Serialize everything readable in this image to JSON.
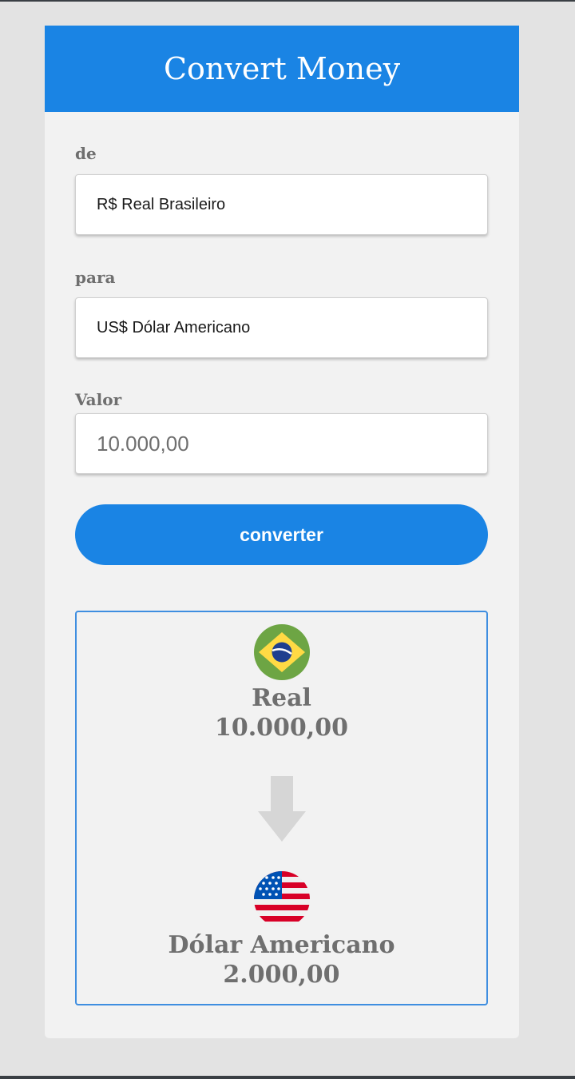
{
  "app": {
    "title": "Convert Money"
  },
  "form": {
    "from_label": "de",
    "from_value": "R$ Real Brasileiro",
    "to_label": "para",
    "to_value": "US$ Dólar Americano",
    "amount_label": "Valor",
    "amount_value": "10.000,00",
    "convert_label": "converter"
  },
  "result": {
    "from_currency": "Real",
    "from_amount": "10.000,00",
    "to_currency": "Dólar Americano",
    "to_amount": "2.000,00",
    "from_flag_icon": "brazil-flag-icon",
    "to_flag_icon": "usa-flag-icon",
    "arrow_icon": "arrow-down-icon"
  },
  "colors": {
    "accent": "#1a84e4",
    "card_bg": "#f2f2f2",
    "page_bg": "#e3e3e3",
    "muted_text": "#6f6f6f",
    "result_border": "#3f8ee0"
  }
}
